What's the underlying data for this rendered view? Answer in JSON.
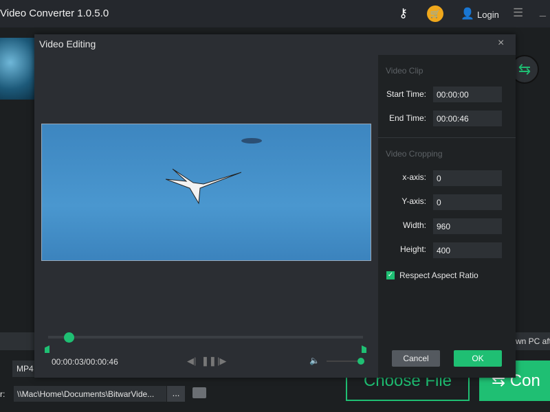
{
  "app": {
    "title": "Video Converter  1.0.5.0",
    "login": "Login"
  },
  "background": {
    "shutdown_text": "wn PC aft",
    "format": "MP4",
    "output_label": "r:",
    "output_path": "\\\\Mac\\Home\\Documents\\BitwarVide...",
    "browse": "...",
    "choose_file": "Choose File",
    "convert": "Con"
  },
  "dialog": {
    "title": "Video Editing",
    "close": "×",
    "player": {
      "time": "00:00:03/00:00:46",
      "progress_fraction": 0.065,
      "volume_fraction": 1.0
    },
    "clip": {
      "header": "Video Clip",
      "start_label": "Start Time:",
      "start": "00:00:00",
      "end_label": "End Time:",
      "end": "00:00:46"
    },
    "crop": {
      "header": "Video Cropping",
      "x_label": "x-axis:",
      "x": "0",
      "y_label": "Y-axis:",
      "y": "0",
      "w_label": "Width:",
      "w": "960",
      "h_label": "Height:",
      "h": "400",
      "aspect_label": "Respect Aspect Ratio",
      "aspect_checked": true
    },
    "cancel": "Cancel",
    "ok": "OK"
  },
  "colors": {
    "accent": "#1fbf73",
    "cart": "#f0a81c"
  }
}
